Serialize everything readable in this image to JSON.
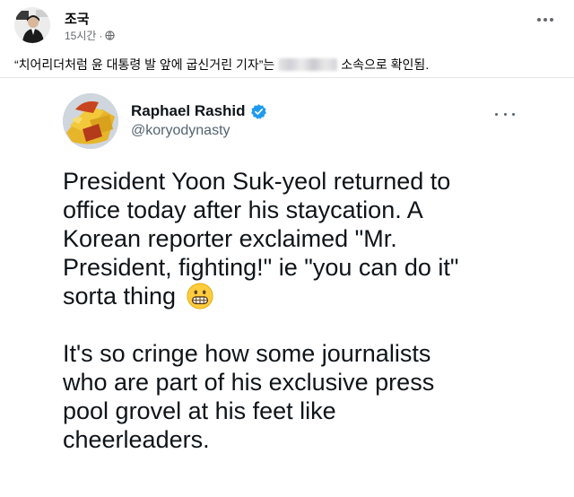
{
  "post": {
    "author": "조국",
    "time": "15시간",
    "separator": "·",
    "caption_before": "“치어리더처럼 윤 대통령 발 앞에 굽신거린 기자”는",
    "caption_after": "소속으로 확인됨."
  },
  "tweet": {
    "display_name": "Raphael Rashid",
    "handle": "@koryodynasty",
    "paragraph1_lines": [
      "President Yoon Suk-yeol returned to",
      "office today after his staycation. A",
      "Korean reporter exclaimed \"Mr.",
      "President, fighting!\" ie \"you can do it\""
    ],
    "paragraph1_last": "sorta thing",
    "paragraph2_lines": [
      "It's so cringe how some journalists",
      "who are part of his exclusive press",
      "pool grovel at his feet like",
      "cheerleaders."
    ]
  },
  "icons": {
    "post_avatar": "profile-photo",
    "globe": "globe-icon",
    "post_menu": "more-horizontal-icon",
    "tweet_avatar": "profile-photo",
    "verified": "verified-badge-icon",
    "tweet_menu": "more-horizontal-icon",
    "emoji": "grimacing-face-emoji"
  },
  "colors": {
    "twitter_blue": "#1d9bf0",
    "secondary_text": "#65676b",
    "tweet_text": "#0f1419",
    "handle_text": "#536471"
  }
}
